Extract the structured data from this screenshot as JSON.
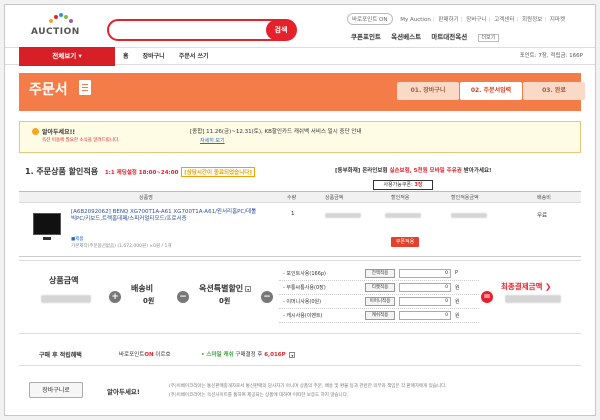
{
  "header": {
    "logo_text": "AUCTION",
    "search_placeholder": "",
    "search_button": "검색",
    "top_links": [
      "바로포인트 ON",
      "My Auction",
      "판매하기",
      "장바구니",
      "고객센터",
      "회원정보",
      "지마켓"
    ],
    "quick_links": [
      "쿠폰포인트",
      "옥션베스트",
      "마트대전옥션"
    ],
    "more_label": "더보기"
  },
  "nav": {
    "all_label": "전체보기",
    "links": [
      "홈",
      "장바구니",
      "주문서 쓰기"
    ],
    "right_text": "포인트: 7장, 적립금: 166P"
  },
  "banner": {
    "title": "주문서",
    "steps": [
      "01. 장바구니",
      "02. 주문서입력",
      "03. 완료"
    ],
    "active_step": 1
  },
  "notice": {
    "head": "알아두세요!!",
    "sub": "옥션 이용에 필요한 소식을 알려드립니다.",
    "message": "[종합] 11.26(금)~12.31(토), KB할인카드 캐쉬백 서비스 일시 중단 안내",
    "link": "자세히 보기"
  },
  "section": {
    "title": "1. 주문상품 할인적용",
    "time_label": "1:1 제딩설정 18:00~24:00",
    "time_badge": "[상담시간이 종료되었습니다]",
    "right_prefix": "[동부화재]",
    "right_middle": "온라인보험",
    "right_red": "실손보험, 5천원 모바일 주유권",
    "right_suffix": "받아가세요!",
    "coupon_note_prefix": "사용가능쿠폰:",
    "coupon_note_count": "3장"
  },
  "table": {
    "headers": [
      "상품명",
      "수량",
      "상품금액",
      "할인적용",
      "할인적용금액",
      "배송비"
    ],
    "rows": [
      {
        "name": "[A6B2092062] BENQ XG700T1A-A61 XG700T1A-A61/윈서리홈PC/데톨빅PC/키보드,트랙홈데패/스피커멀티모드/프로서증",
        "tag": "■제품",
        "sub": "기본제작(주문옵션없음) (1,672,000원) ×0원 / 1개",
        "qty": "1",
        "coupon_button": "쿠폰적용",
        "shipping": "무료"
      }
    ]
  },
  "totals": {
    "product_label": "상품금액",
    "shipping_label": "배송비",
    "shipping_value": "0원",
    "special_label": "옥션특별할인",
    "special_value": "0원",
    "final_label": "최종결제금액",
    "discounts": [
      {
        "label": "- 포인트사용(166p)",
        "button": "전액적용",
        "value": "0",
        "unit": "P"
      },
      {
        "label": "- 무통씨통사용(0장)",
        "button": "티켓적용",
        "value": "0",
        "unit": "원"
      },
      {
        "label": "- 이머니사용(0원)",
        "button": "이머니적용",
        "value": "0",
        "unit": "원"
      },
      {
        "label": "- 캐시사용(이벤트)",
        "button": "캐쉬적용",
        "value": "0",
        "unit": "원"
      }
    ]
  },
  "reward": {
    "label": "구매 후 적립혜택",
    "on_prefix": "바로포인트",
    "on_red": "ON",
    "on_suffix": "이르호",
    "smile_green": "• 스마일 캐쉬",
    "smile_mid": "구매결정 후",
    "smile_red": "6,016P"
  },
  "bottom": {
    "cart_button": "장바구니로",
    "head": "알아두세요!",
    "fine_1": "(주)이베이코리아는 통신판매중개자로서 통신판매의 당사자가 아니며 상품의 주문, 배송 및 환불 등과 관련한 의무와 책임은 각 판매자에게 있습니다.",
    "fine_2": "(주)이베이코리아는 옥션사이트를 통하여 제공되는 상품에 대하여 어떠한 보증도 하지 않습니다."
  },
  "colors": {
    "accent": "#e5212b",
    "banner": "#f37c48"
  }
}
